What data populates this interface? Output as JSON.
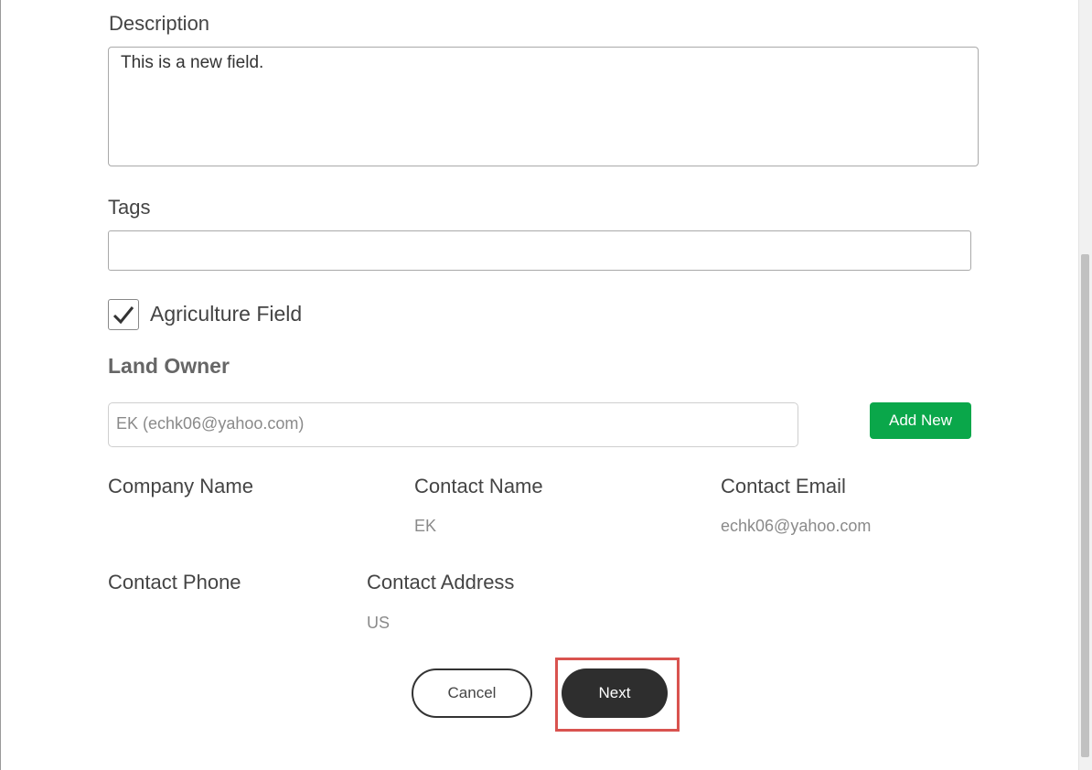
{
  "form": {
    "description_label": "Description",
    "description_value": "This is a new field.",
    "tags_label": "Tags",
    "tags_value": "",
    "agriculture_label": "Agriculture Field",
    "agriculture_checked": true
  },
  "land_owner": {
    "title": "Land Owner",
    "selected": "EK (echk06@yahoo.com)",
    "add_new_label": "Add New",
    "company_name_label": "Company Name",
    "company_name_value": "",
    "contact_name_label": "Contact Name",
    "contact_name_value": "EK",
    "contact_email_label": "Contact Email",
    "contact_email_value": "echk06@yahoo.com",
    "contact_phone_label": "Contact Phone",
    "contact_phone_value": "",
    "contact_address_label": "Contact Address",
    "contact_address_value": "US"
  },
  "actions": {
    "cancel_label": "Cancel",
    "next_label": "Next"
  },
  "colors": {
    "add_new_bg": "#0aa74a",
    "next_bg": "#2e2e2e",
    "highlight": "#d9534f"
  },
  "icons": {
    "checkbox_check": "check-icon"
  }
}
